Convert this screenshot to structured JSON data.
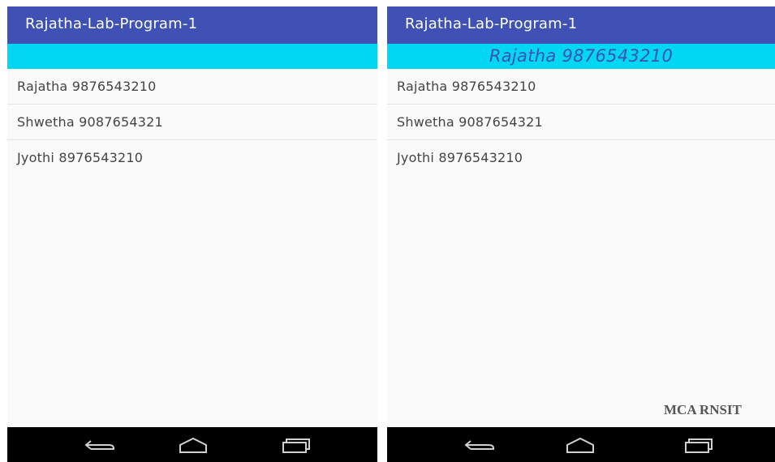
{
  "screens": {
    "left": {
      "app_title": "Rajatha-Lab-Program-1",
      "selected_text": "",
      "contacts": [
        {
          "label": "Rajatha 9876543210"
        },
        {
          "label": "Shwetha 9087654321"
        },
        {
          "label": "Jyothi 8976543210"
        }
      ]
    },
    "right": {
      "app_title": "Rajatha-Lab-Program-1",
      "selected_text": "Rajatha 9876543210",
      "contacts": [
        {
          "label": "Rajatha 9876543210"
        },
        {
          "label": "Shwetha 9087654321"
        },
        {
          "label": "Jyothi 8976543210"
        }
      ]
    }
  },
  "navbar": {
    "buttons": [
      {
        "icon": "back-icon"
      },
      {
        "icon": "home-icon"
      },
      {
        "icon": "recent-apps-icon"
      }
    ]
  },
  "watermark": "MCA RNSIT",
  "colors": {
    "appbar": "#3f51b5",
    "selected_bar": "#00d8f2",
    "selected_text": "#3f51b5",
    "list_background": "#fafafa",
    "navbar": "#000000"
  }
}
